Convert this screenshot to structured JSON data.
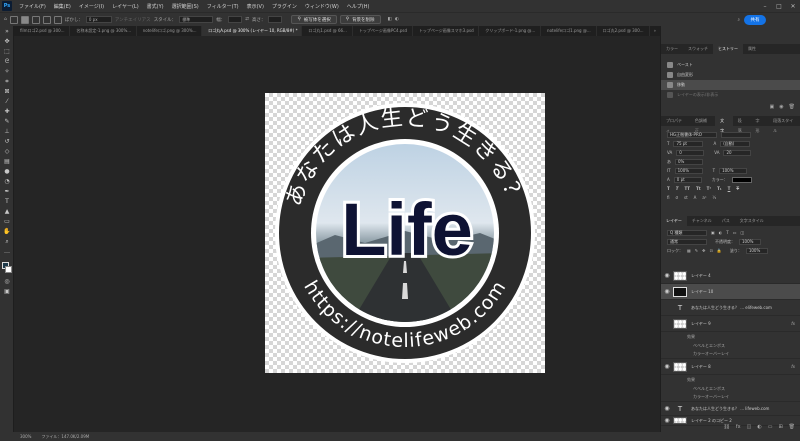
{
  "app": {
    "logo": "Ps"
  },
  "menu": [
    "ファイル(F)",
    "編集(E)",
    "イメージ(I)",
    "レイヤー(L)",
    "書式(Y)",
    "選択範囲(S)",
    "フィルター(T)",
    "表示(V)",
    "プラグイン",
    "ウィンドウ(W)",
    "ヘルプ(H)"
  ],
  "options": {
    "feather_label": "ぼかし：",
    "feather_value": "0 px",
    "antialias": "アンチエイリアス",
    "style_label": "スタイル：",
    "style_value": "標準",
    "width_label": "幅：",
    "height_label": "高さ：",
    "select_subject": "被写体を選択",
    "remove_bg": "背景を削除",
    "share": "共有"
  },
  "tabs": [
    {
      "label": "filmロゴ2.psd @ 300...",
      "active": false
    },
    {
      "label": "名称未設定-1.png @ 300%...",
      "active": false
    },
    {
      "label": "notelifeロゴ.png @ 300%...",
      "active": false
    },
    {
      "label": "ロゴ丸A.psd @ 300% (レイヤー 10, RGB/8#) *",
      "active": true
    },
    {
      "label": "ロゴ丸1.psd @ 66...",
      "active": false
    },
    {
      "label": "トップページ画像PC4.psd",
      "active": false
    },
    {
      "label": "トップページ画像スマホ3.psd",
      "active": false
    },
    {
      "label": "クリップボード-1.png @...",
      "active": false
    },
    {
      "label": "notelifeロゴ1.png @...",
      "active": false
    },
    {
      "label": "ロゴ丸2.psd @ 300...",
      "active": false
    }
  ],
  "canvas": {
    "arc_top_text": "あなたは人生どう生きる？",
    "arc_bottom_text": "https://notelifeweb.com",
    "center_text": "Life",
    "colors": {
      "ring": "#2b2b2b",
      "navy": "#0e1233",
      "white": "#ffffff",
      "sky": "#c9d8e6"
    }
  },
  "status": {
    "zoom": "300%",
    "file": "ファイル：147.0K/2.09M"
  },
  "history_panel": {
    "tabs": [
      "カラー",
      "スウォッチ",
      "ヒストリー",
      "属性"
    ],
    "active_tab": "ヒストリー",
    "items": [
      {
        "label": "ペースト",
        "state": "normal"
      },
      {
        "label": "自由変形",
        "state": "normal"
      },
      {
        "label": "移動",
        "state": "selected"
      },
      {
        "label": "レイヤーの表示/非表示",
        "state": "dim"
      }
    ]
  },
  "character_panel": {
    "tabs": [
      "プロパティ",
      "色調補正",
      "文字",
      "段落",
      "字形",
      "段落スタイル"
    ],
    "active_tab": "文字",
    "font": "HG正楷書体-PRO",
    "size": "75 pt",
    "leading": "(自動)",
    "kerning": "0",
    "tracking": "20",
    "tsume": "0%",
    "vscale": "100%",
    "hscale": "100%",
    "baseline": "0 pt",
    "color_label": "カラー："
  },
  "layers_panel": {
    "tabs": [
      "レイヤー",
      "チャンネル",
      "パス",
      "文字スタイル"
    ],
    "active_tab": "レイヤー",
    "filter": "Q 種類",
    "blend": "通常",
    "opacity_label": "不透明度：",
    "opacity": "100%",
    "lock_label": "ロック：",
    "fill_label": "塗り：",
    "fill": "100%",
    "layers": [
      {
        "name": "レイヤー 4",
        "kind": "pixel",
        "fx": false,
        "selected": false
      },
      {
        "name": "レイヤー 10",
        "kind": "pixel",
        "fx": false,
        "selected": true
      },
      {
        "name": "あなたは人生どう生きる？ ... elifeweb.com",
        "kind": "text",
        "fx": false,
        "selected": false
      },
      {
        "name": "レイヤー 9",
        "kind": "pixel",
        "fx": true,
        "selected": false
      },
      {
        "name": "効果",
        "kind": "sub",
        "fx": false,
        "selected": false
      },
      {
        "name": "ベベルとエンボス",
        "kind": "sub",
        "fx": false,
        "selected": false
      },
      {
        "name": "カラーオーバーレイ",
        "kind": "sub",
        "fx": false,
        "selected": false
      },
      {
        "name": "レイヤー 8",
        "kind": "pixel",
        "fx": true,
        "selected": false
      },
      {
        "name": "効果",
        "kind": "sub",
        "fx": false,
        "selected": false
      },
      {
        "name": "ベベルとエンボス",
        "kind": "sub",
        "fx": false,
        "selected": false
      },
      {
        "name": "カラーオーバーレイ",
        "kind": "sub",
        "fx": false,
        "selected": false
      },
      {
        "name": "あなたは人生どう生きる？ ... lifeweb.com",
        "kind": "text",
        "fx": false,
        "selected": false
      },
      {
        "name": "レイヤー 2 のコピー 2",
        "kind": "pixel",
        "fx": false,
        "selected": false
      }
    ]
  }
}
